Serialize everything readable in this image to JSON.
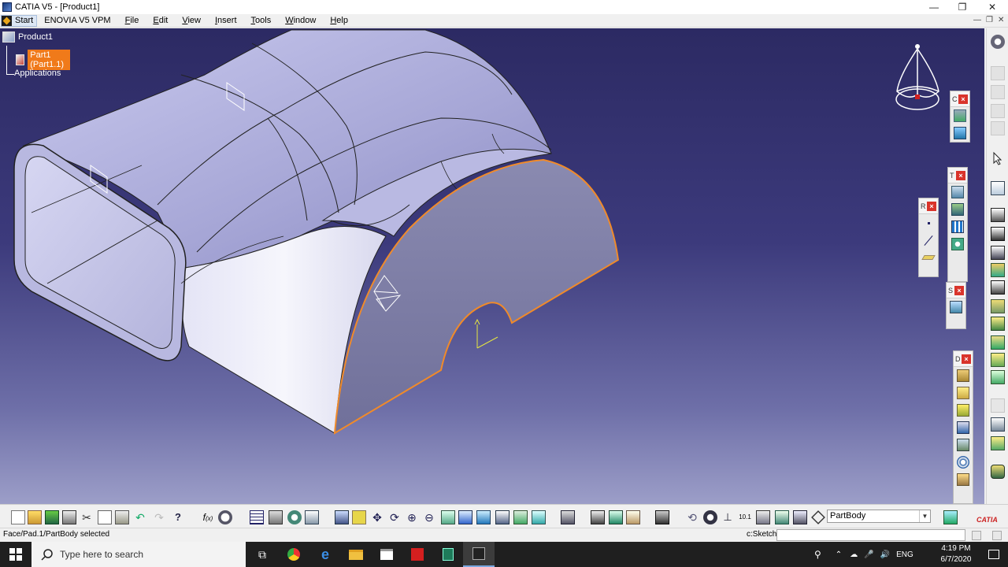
{
  "window": {
    "title": "CATIA V5 - [Product1]"
  },
  "menu": {
    "start": "Start",
    "items": [
      "ENOVIA V5 VPM",
      "File",
      "Edit",
      "View",
      "Insert",
      "Tools",
      "Window",
      "Help"
    ]
  },
  "tree": {
    "root": "Product1",
    "part": "Part1 (Part1.1)",
    "applications": "Applications"
  },
  "floating_toolbars": [
    {
      "letter": "C"
    },
    {
      "letter": "T"
    },
    {
      "letter": "R"
    },
    {
      "letter": "S"
    },
    {
      "letter": "D"
    }
  ],
  "toolbar": {
    "body_select": "PartBody"
  },
  "status": {
    "message": "Face/Pad.1/PartBody selected",
    "command_label": "c:Sketch",
    "command_value": ""
  },
  "taskbar": {
    "search_placeholder": "Type here to search",
    "lang": "ENG",
    "time": "4:19 PM",
    "date": "6/7/2020"
  },
  "colors": {
    "viewport_top": "#2c2a63",
    "viewport_bottom": "#9c9ec8",
    "selection": "#f07a1a",
    "edge_highlight": "#f08a2a"
  }
}
